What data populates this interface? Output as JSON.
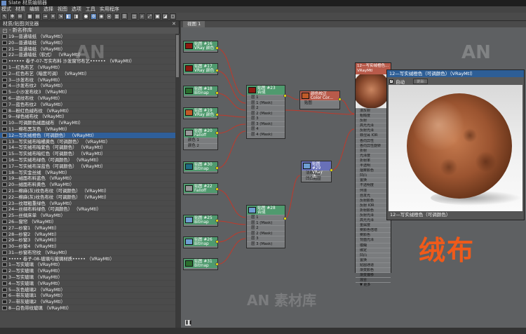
{
  "window": {
    "title": "Slate 材质编辑器"
  },
  "menu": [
    "模式",
    "材质",
    "编辑",
    "选择",
    "视图",
    "选项",
    "工具",
    "实用程序"
  ],
  "toolbar_icons": [
    "select-icon",
    "pan-icon",
    "move-icon",
    "grid-icon",
    "layout-icon",
    "assign-icon",
    "delete-icon",
    "move-children-icon",
    "show-map-icon",
    "show-bg-icon",
    "render-icon",
    "layout-all-icon",
    "hide-icon",
    "pick-icon",
    "arrange-icon",
    "nav-icon",
    "options-icon",
    "zoom-icon",
    "fit-icon",
    "bg-icon",
    "material-map-icon",
    "extra-icon"
  ],
  "left_panel": {
    "title": "材质/贴图浏览器",
    "section": "- 新名称库",
    "items": [
      "19—普通墙纸   （VRayMtl）",
      "20—普通墙纸   （VRayMtl）",
      "21—普通墙纸   （VRayMtl）",
      "22—普通墙纸（软式）  （VRayMtl）",
      "•••••• 卷子-07-写实布料 沙发窗帘布艺••••••  （VRayMtl）",
      "1—红色布艺  （VRayMtl）",
      "2—红色布艺（暗度可调）  （VRayMtl）",
      "3—沙发布纹  （VRayMtl）",
      "4—沙发布纹2  （VRayMtl）",
      "5—小沙发布纹3  （VRayMtl）",
      "6—遮纹布纹  （VRayMtl）",
      "7—蓝色布纹2  （VRayMtl）",
      "8—粉红色绒布纹  （VRayMtl）",
      "9—绿色绒布纹  （VRayMtl）",
      "10—可调颜色绒面绒布  （VRayMtl）",
      "11—棉布黑灰色  （VRayMtl）",
      "12—写实绒橙色（可调颜色）  （VRayMtl）",
      "13—写实绒布暗橘黄色（可调颜色）  （VRayMtl）",
      "14—写实绒布暗紫色（可调颜色）  （VRayMtl）",
      "15—写实绒布暗红色（可调颜色）  （VRayMtl）",
      "16—写实绒布绿色（可调颜色）  （VRayMtl）",
      "17—写实绒布深蓝色（可调颜色）  （VRayMtl）",
      "18—写实金丝绒  （VRayMtl）",
      "19—绒面布料蓝色  （VRayMtl）",
      "20—绒面布料黄色  （VRayMtl）",
      "21—棉麻(灰)纹色布纹（可调颜色）  （VRayMtl）",
      "22—棉麻(灰)纹色布纹（可调颜色）  （VRayMtl）",
      "23—纹理粗重绿色  （VRayMtl）",
      "24—丝绸布料绿色（可调颜色）  （VRayMtl）",
      "25—丝绸床单  （VRayMtl）",
      "26—窗帘  （VRayMtl）",
      "27—纱窗1  （VRayMtl）",
      "28—纱窗2  （VRayMtl）",
      "29—纱窗3  （VRayMtl）",
      "30—纱窗4  （VRayMtl）",
      "31—纱窗布帘纹  （VRayMtl）",
      "••••• 卷子-08-玻璃与玻璃材质••••• （VRayMtl）",
      "1—写实玻璃  （VRayMtl）",
      "2—写实玻璃  （VRayMtl）",
      "3—写实玻璃  （VRayMtl）",
      "4—写实玻璃  （VRayMtl）",
      "5—灰色玻璃2  （VRayMtl）",
      "6—带灰玻璃1  （VRayMtl）",
      "7—带灰玻璃2  （VRayMtl）",
      "8—白色带纹玻璃  （VRayMtl）"
    ],
    "selected_index": 16
  },
  "view": {
    "tab": "视图 1"
  },
  "nodes": {
    "n16": {
      "title": "贴图 #16",
      "sub": "VRay 颜色"
    },
    "n17": {
      "title": "贴图 #17",
      "sub": "VRay 颜色"
    },
    "n18": {
      "title": "贴图 #18",
      "sub": "Bitmap"
    },
    "n19": {
      "title": "贴图 #19",
      "sub": "VRay 颜色"
    },
    "n20": {
      "title": "贴图 #20",
      "sub": "Falloff",
      "ports": [
        "颜色 1",
        "颜色 2"
      ]
    },
    "n30": {
      "title": "贴图 #30",
      "sub": "Bitmap"
    },
    "n22": {
      "title": "贴图 #22",
      "sub": "Falloff"
    },
    "n25": {
      "title": "贴图 #25",
      "sub": "Bitmap"
    },
    "n26": {
      "title": "贴图 #26",
      "sub": "Bitmap"
    },
    "n31": {
      "title": "贴图 #31",
      "sub": "Bitmap"
    },
    "n23": {
      "title": "贴图 #23",
      "sub": "合成",
      "ports": [
        "层 1",
        "层 1 (Mask)",
        "层 2",
        "层 2 (Mask)",
        "层 3",
        "层 3 (Mask)",
        "层 4",
        "层 4 (Mask)"
      ]
    },
    "ncc": {
      "title": "颜色校正",
      "sub": "Color Cor...",
      "ports": [
        "贴图"
      ]
    },
    "n29": {
      "title": "贴图 #29",
      "sub": "VRay 法...",
      "ports": [
        "法线贴图",
        "凹凸贴图"
      ]
    },
    "n28": {
      "title": "贴图 #28",
      "sub": "合成",
      "ports": [
        "层 1",
        "层 1 (Mask)",
        "层 2",
        "层 2 (Mask)",
        "层 3",
        "层 3 (Mask)"
      ]
    }
  },
  "output_node": {
    "title": "12—写实绒橙色...",
    "sub": "VRayMtl",
    "ports": [
      "漫反射",
      "粗糙度",
      "反射",
      "高光光泽",
      "反射光泽",
      "菲涅耳 IOR",
      "各向异性",
      "各向异性旋转",
      "折射",
      "光泽度",
      "折射率",
      "半透明",
      "烟雾颜色",
      "凹凸",
      "置换",
      "不透明度",
      "环境",
      "自发光",
      "反射颜色",
      "反射 IOR",
      "折射颜色",
      "反射光泽",
      "高光光泽",
      "金属度",
      "雾颜色倍增",
      "雾颜色",
      "背面光泽",
      "模糊",
      "绑定",
      "凹凸",
      "置换",
      "贴图通道",
      "渐变颜色",
      "渐变偏移",
      "混合"
    ],
    "footer": "▼  更多"
  },
  "preview": {
    "title": "12—写实绒橙色（可调颜色）（VRayMtl）",
    "auto_label": "自动",
    "update_label": "更新",
    "footer": "12—写实绒橙色（可调颜色）"
  },
  "overlay_text": "绒布",
  "watermarks": [
    "AN",
    "AN",
    "AN 素材库"
  ],
  "colors": {
    "accent": "#2f5f9a",
    "node_green": "#4f9a6e",
    "wire_red": "#c0392b",
    "overlay_orange": "#f05a1a"
  }
}
